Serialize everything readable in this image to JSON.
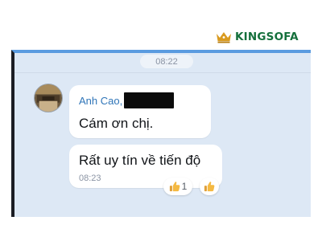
{
  "brand": {
    "name": "KINGSOFA",
    "color": "#15703c",
    "accent": "#d99a1f"
  },
  "chat": {
    "time_divider": "08:22",
    "messages": [
      {
        "sender": "Anh Cao,",
        "sender_redacted": true,
        "text": "Cám ơn chị."
      },
      {
        "text": "Rất uy tín về tiến độ",
        "time": "08:23",
        "reactions": {
          "count": "1",
          "icon": "thumbs-up-icon"
        }
      }
    ]
  },
  "colors": {
    "chat_background": "#dde8f5",
    "sender_name": "#2f75b8",
    "top_bar": "#5a9be0"
  }
}
